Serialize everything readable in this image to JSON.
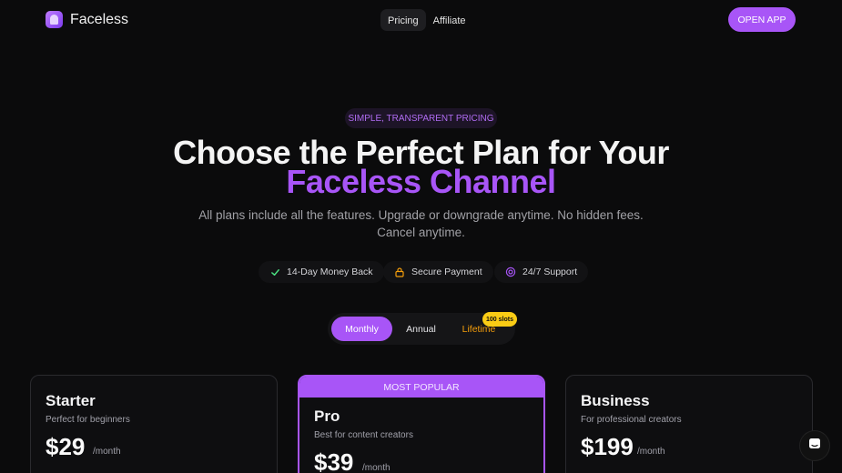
{
  "brand": {
    "name": "Faceless"
  },
  "nav": {
    "items": [
      {
        "label": "Pricing",
        "active": true
      },
      {
        "label": "Affiliate",
        "active": false
      }
    ]
  },
  "header": {
    "cta_label": "OPEN APP"
  },
  "hero": {
    "eyebrow": "SIMPLE, TRANSPARENT PRICING",
    "title_line1": "Choose the Perfect Plan for Your",
    "title_line2": "Faceless Channel",
    "subtitle_line1": "All plans include all the features. Upgrade or downgrade anytime. No hidden fees.",
    "subtitle_line2": "Cancel anytime."
  },
  "trust": [
    {
      "icon": "check-icon",
      "label": "14-Day Money Back"
    },
    {
      "icon": "lock-icon",
      "label": "Secure Payment"
    },
    {
      "icon": "support-icon",
      "label": "24/7 Support"
    }
  ],
  "billing_toggle": {
    "options": [
      "Monthly",
      "Annual",
      "Lifetime"
    ],
    "selected": "Monthly",
    "lifetime_badge": "100 slots"
  },
  "plans": [
    {
      "name": "Starter",
      "description": "Perfect for beginners",
      "price": "$29",
      "period": "/month"
    },
    {
      "name": "Pro",
      "description": "Best for content creators",
      "price": "$39",
      "period": "/month",
      "badge": "MOST POPULAR"
    },
    {
      "name": "Business",
      "description": "For professional creators",
      "price": "$199",
      "period": "/month"
    }
  ],
  "colors": {
    "accent": "#a855f7",
    "background": "#0b0b0c",
    "badge": "#facc15",
    "lifetime": "#f59e0b"
  }
}
